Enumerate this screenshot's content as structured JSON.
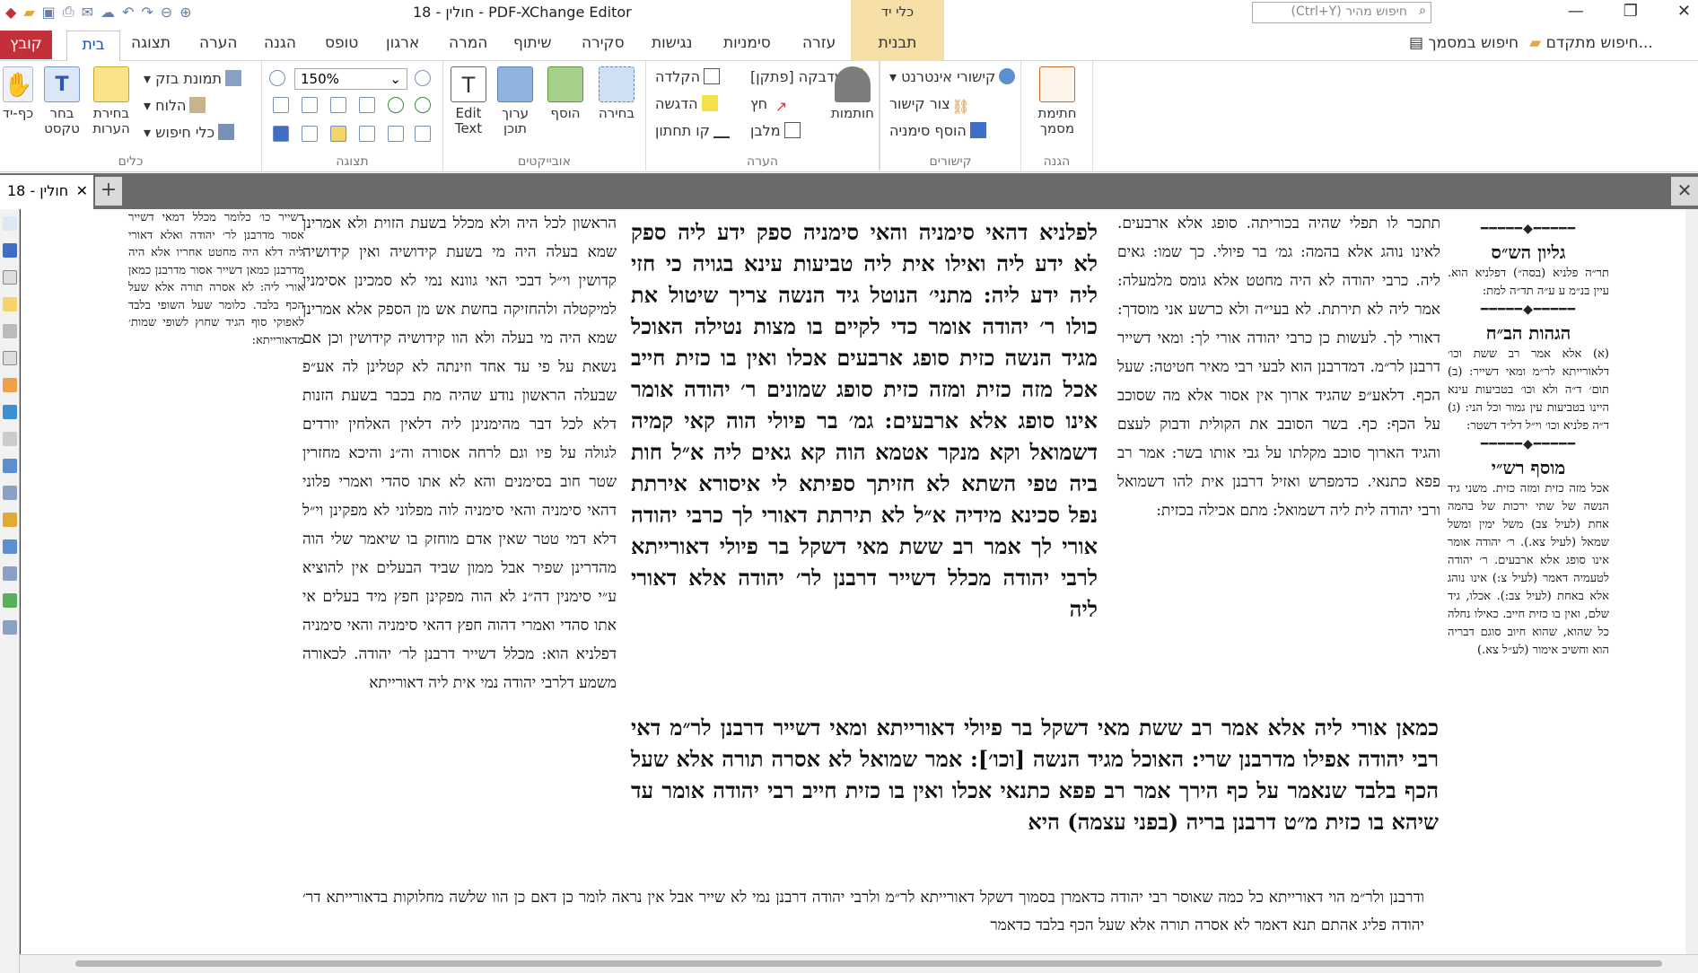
{
  "window": {
    "title": "18 - חולין - PDF-XChange Editor",
    "context_group": "כלי יד",
    "search_placeholder": "חיפוש מהיר (Ctrl+Y)"
  },
  "ribbon_tabs": {
    "file": "קובץ",
    "home": "בית",
    "items": [
      "תצוגה",
      "הערה",
      "הגנה",
      "טופס",
      "ארגון",
      "המרה",
      "שיתוף",
      "סקירה",
      "נגישות",
      "סימניות",
      "עזרה"
    ],
    "context": "תבנית",
    "find_doc": "חיפוש במסמך",
    "adv_search": "חיפוש מתקדם..."
  },
  "ribbon": {
    "tools_group": "כלים",
    "view_group": "תצוגה",
    "objects_group": "אובייקטים",
    "comment_group": "הערה",
    "links_group": "קישורים",
    "protect_group": "הגנה",
    "hand_tool": "כף-יד",
    "select_text": "בחר טקסט",
    "select_comments": "בחירת הערות",
    "snapshot": "תמונת בזק",
    "clipboard": "הלוח",
    "search_tools": "כלי חיפוש",
    "zoom": "150%",
    "edit_text": "Edit Text",
    "edit_content": "ערוך תוכן",
    "add": "הוסף",
    "select": "בחירה",
    "typewriter": "הקלדה",
    "highlight": "הדגשה",
    "underline": "קו תחתון",
    "sticky_note": "מדבקה [פתקן]",
    "arrow": "חץ",
    "rectangle": "מלבן",
    "stamps": "חותמות",
    "web_links": "קישורי אינטרנט",
    "create_link": "צור קישור",
    "add_bookmark": "הוסף סימניה",
    "sign_doc": "חתימת מסמך"
  },
  "doc_tab": {
    "label": "חולין - 18"
  },
  "page": {
    "left_note": "דשייר כו׳ כלומר מכלל דמאי דשייר אסור מדרבנן לר׳ יהודה ואלא דאורי ליה דלא היה מחטט אחריו אלא היה מדרבנן כמאן דשייר אסור מדרבנן כמאן אורי ליה: לא אסרה תורה אלא שעל הכף בלבד. כלומר שעל השופי בלבד לאפוקי סוף הגיד שחוץ לשופי שמות׳ מדאורייתא:",
    "rashi": "הראשון לכל היה ולא מכלל בשעת הזוית ולא אמרינן שמא בעלה היה מי בשעת קידושיה ואין קידושיה קדושין וי״ל דבכי האי גוונא נמי לא סמכינן אסימנין למיקטלה ולהחזיקה בחשת אש מן הספק אלא אמרינן שמא היה מי בעלה ולא הוו קידושיה קידושין וכן אם נשאת על פי עד אחד וזינתה לא קטלינן לה אע״פ שבעלה הראשון נודע שהיה מת בכבר בשעת הזנות דלא לכל דבר מהימנינן ליה דלאין האלחין יורדים לגולה על פיו וגם לרחה אסורה וה״נ והיכא מחזרין שטר חוב בסימנים והא לא אתו סהדי ואמרי פלוני דהאי סימניה והאי סימניה לוה מפלוני לא מפקינן וי״ל דלא דמי טטר שאין אדם מוחזק בו שיאמר שלי הוה מהדרינן שפיר אבל ממון שביד הבעלים אין להוציא ע״י סימנין דה״נ לא הוה מפקינן חפץ מיד בעלים אי אתו סהדי ואמרי דהוה חפץ דהאי סימניה והאי סימניה דפלניא הוא: מכלל דשייר דרבנן לר׳ יהודה. לכאורה משמע דלרבי יהודה נמי אית ליה דאורייתא",
    "gemara": "לפלניא דהאי סימניה והאי סימניה ספק ידע ליה ספק לא ידע ליה ואילו אית ליה טביעות עינא בגויה כי חזי ליה ידע ליה: מתני׳ הנוטל גיד הנשה צריך שיטול את כולו ר׳ יהודה אומר כדי לקיים בו מצות נטילה האוכל מגיד הנשה כזית סופג ארבעים אכלו ואין בו כזית חייב אכל מזה כזית ומזה כזית סופג שמונים ר׳ יהודה אומר אינו סופג אלא ארבעים: גמ׳ בר פיולי הוה קאי קמיה דשמואל וקא מנקר אטמא הוה קא גאים ליה א״ל חות ביה טפי השתא לא חזיתך ספיתא לי איסורא אירתת נפל סכינא מידיה א״ל לא תירתת דאורי לך כרבי יהודה אורי לך אמר רב ששת מאי דשקל בר פיולי דאורייתא לרבי יהודה מכלל דשייר דרבנן לר׳ יהודה אלא דאורי ליה",
    "gemara_wide": "כמאן אורי ליה אלא אמר רב ששת מאי דשקל בר פיולי דאורייתא ומאי דשייר דרבנן לר״מ דאי רבי יהודה אפילו מדרבנן שרי: האוכל מגיד הנשה [וכו׳]: אמר שמואל לא אסרה תורה אלא שעל הכף בלבד שנאמר על כף הירך אמר רב פפא כתנאי אכלו ואין בו כזית חייב רבי יהודה אומר עד שיהא בו כזית מ״ט דרבנן בריה (בפני עצמה) היא",
    "tosafot": "תתכר לו תפלי שהיה בכוריתה. סופג אלא ארבעים. לאינו נוהג אלא בהמה: גמ׳ בר פיולי. כך שמו: גאים ליה. כרבי יהודה לא היה מחטט אלא גומס מלמעלה: אמר ליה לא תירתת. לא בעי״ה ולא כרשע אני מוסדך: דאורי לך. לעשות כן כרבי יהודה אורי לך: ומאי דשייר דרבנן לר״מ. דמדרבנן הוא לבעי רבי מאיר חטיטה: שעל הכף. דלאע״פ שהגיד ארוך אין אסור אלא מה שסוכב על הכף: כף. בשר הסובב את הקולית ודבוק לעצם והגיד הארוך סוכב מקלתו על גבי אותו בשר: אמר רב פפא כתנאי. כדמפרש ואזיל דרבנן אית להו דשמואל ורבי יהודה לית ליה דשמואל: מתם אכילה בכזית:",
    "tosafot_bottom": "ודרבנן ולר״מ הוי דאורייתא כל כמה שאוסר רבי יהודה כדאמרן בסמוך דשקל דאורייתא לר״מ ולרבי יהודה דרבנן נמי לא שייר אבל אין נראה לומר כן דאם כן הוו שלשה מחלוקות בדאורייתא דר׳ יהודה פליג אהתם תנא דאמר לא אסרה תורה אלא שעל הכף בלבד כדאמר",
    "margin": {
      "h1": "גליון הש״ס",
      "t1": "תר״ה פלניא (בסה״) דפלניא הוא. עיין בנ״מ ע ע״ה תד״ה למת:",
      "h2": "הגהות הב״ח",
      "t2": "(א) אלא אמר רב ששת וכו׳ דלאורייתא לר״מ ומאי דשייר: (ב) תום׳ ד״ה ולא וכו׳ בטביעות עינא היינו בטביעות עין גמור וכל הני: (ג) ד״ה פלניא וכו׳ וי״ל דל״ד דשטר:",
      "h3": "מוסף רש״י",
      "t3": "אכל מזה כזית ומזה כזית. משני גיד הנשה של שתי ירכות של בהמה אחת (לעיל צב) משל ימין ומשל שמאל (לעיל צא.). ר׳ יהודה אומר אינו סופג אלא ארבעים. ר׳ יהודה לטעמיה דאמר (לעיל צ:) אינו נוהג אלא באחת (לעיל צב:). אכלו, גיד שלם, ואין בו כזית חייב. כאילו נחלה כל שהוא, שהוא חיוב סוגם דבריה הוא וחשיב אימור (לע״ל צא.)"
    }
  }
}
